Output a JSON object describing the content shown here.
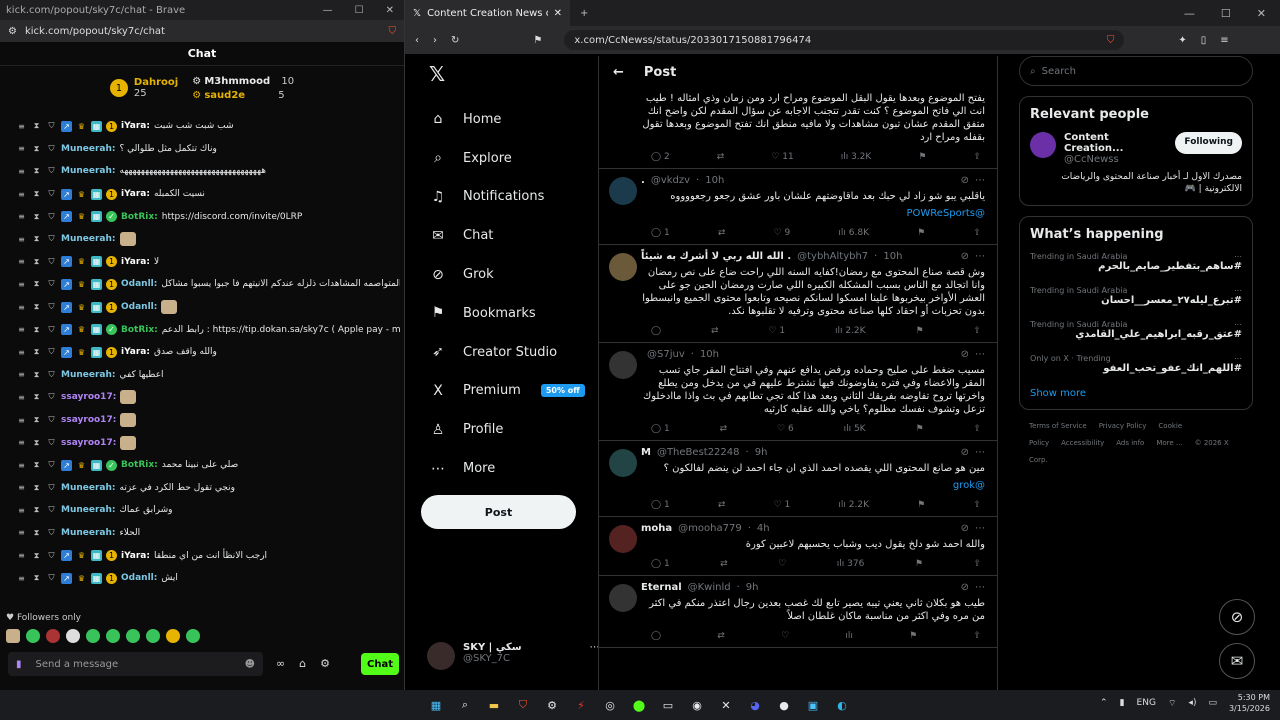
{
  "left_window": {
    "title": "kick.com/popout/sky7c/chat - Brave",
    "url": "kick.com/popout/sky7c/chat",
    "chat_title": "Chat",
    "leaderboard": [
      {
        "rank": "1",
        "name": "Dahrooj",
        "count": "25"
      },
      {
        "name": "M3hmmood",
        "count": "10"
      },
      {
        "name": "saud2e",
        "count": "5"
      }
    ],
    "messages": [
      {
        "user": "iYara:",
        "color": "#ffffff",
        "badges": [
          "b1",
          "b1",
          "b1",
          "b2",
          "b4",
          "b3",
          "b5"
        ],
        "text": "شب شبت شب شبت"
      },
      {
        "user": "Muneerah:",
        "color": "#7ec8e3",
        "badges": [
          "b1",
          "b1",
          "b1"
        ],
        "text": "وناك تتكمل مثل طلوالي ؟"
      },
      {
        "user": "Muneerah:",
        "color": "#7ec8e3",
        "badges": [
          "b1",
          "b1",
          "b1"
        ],
        "text": "ههههههههههههههههههههههههههههههههههه"
      },
      {
        "user": "iYara:",
        "color": "#ffffff",
        "badges": [
          "b1",
          "b1",
          "b1",
          "b2",
          "b4",
          "b3",
          "b5"
        ],
        "text": "نسيت الكمبله"
      },
      {
        "user": "BotRix:",
        "color": "#38c45a",
        "badges": [
          "b1",
          "b1",
          "b1",
          "b2",
          "b4",
          "b3",
          "b6"
        ],
        "text": "https://discord.com/invite/0LRP"
      },
      {
        "user": "Muneerah:",
        "color": "#7ec8e3",
        "badges": [
          "b1",
          "b1",
          "b1"
        ],
        "text": "",
        "emote": true
      },
      {
        "user": "iYara:",
        "color": "#ffffff",
        "badges": [
          "b1",
          "b1",
          "b1",
          "b2",
          "b4",
          "b3",
          "b5"
        ],
        "text": "لا"
      },
      {
        "user": "Odanll:",
        "color": "#7ec8e3",
        "badges": [
          "b1",
          "b1",
          "b1",
          "b2",
          "b4",
          "b3",
          "b5"
        ],
        "text": "للعزه الثانيه ويكمت تصري المتواصمه المشاهدات ذلزله عندكم الانيتهم فا جبوا يسبوا مشاكل"
      },
      {
        "user": "Odanll:",
        "color": "#7ec8e3",
        "badges": [
          "b1",
          "b1",
          "b1",
          "b2",
          "b4",
          "b3",
          "b5"
        ],
        "text": "",
        "emote": true
      },
      {
        "user": "BotRix:",
        "color": "#38c45a",
        "badges": [
          "b1",
          "b1",
          "b1",
          "b2",
          "b4",
          "b3",
          "b6"
        ],
        "text": "رابط الدعم : https://tip.dokan.sa/sky7c ( Apple pay - mada - Visa"
      },
      {
        "user": "iYara:",
        "color": "#ffffff",
        "badges": [
          "b1",
          "b1",
          "b1",
          "b2",
          "b4",
          "b3",
          "b5"
        ],
        "text": "والله واقف صدق"
      },
      {
        "user": "Muneerah:",
        "color": "#7ec8e3",
        "badges": [
          "b1",
          "b1",
          "b1"
        ],
        "text": "اعطيها كفي"
      },
      {
        "user": "ssayroo17:",
        "color": "#b084f5",
        "badges": [
          "b1",
          "b1",
          "b1"
        ],
        "text": "",
        "emote": true
      },
      {
        "user": "ssayroo17:",
        "color": "#b084f5",
        "badges": [
          "b1",
          "b1",
          "b1"
        ],
        "text": "",
        "emote": true
      },
      {
        "user": "ssayroo17:",
        "color": "#b084f5",
        "badges": [
          "b1",
          "b1",
          "b1"
        ],
        "text": "",
        "emote": true
      },
      {
        "user": "BotRix:",
        "color": "#38c45a",
        "badges": [
          "b1",
          "b1",
          "b1",
          "b2",
          "b4",
          "b3",
          "b6"
        ],
        "text": "صلي على نبينا محمد"
      },
      {
        "user": "Muneerah:",
        "color": "#7ec8e3",
        "badges": [
          "b1",
          "b1",
          "b1"
        ],
        "text": "ونجي تقول حط الكرد في عزته"
      },
      {
        "user": "Muneerah:",
        "color": "#7ec8e3",
        "badges": [
          "b1",
          "b1",
          "b1"
        ],
        "text": "وشرابق عماك"
      },
      {
        "user": "Muneerah:",
        "color": "#7ec8e3",
        "badges": [
          "b1",
          "b1",
          "b1"
        ],
        "text": "الحلاء"
      },
      {
        "user": "iYara:",
        "color": "#ffffff",
        "badges": [
          "b1",
          "b1",
          "b1",
          "b2",
          "b4",
          "b3",
          "b5"
        ],
        "text": "ارجب الانظأ انت من اي منطقا"
      },
      {
        "user": "Odanll:",
        "color": "#7ec8e3",
        "badges": [
          "b1",
          "b1",
          "b1",
          "b2",
          "b4",
          "b3",
          "b5"
        ],
        "text": "ايش"
      }
    ],
    "followers_only": "Followers only",
    "send_placeholder": "Send a message",
    "chat_button": "Chat"
  },
  "right_window": {
    "tab_title": "Content Creation News on X: \"",
    "url": "x.com/CcNewss/status/2033017150881796474",
    "nav": [
      {
        "label": "Home",
        "icon": "⌂"
      },
      {
        "label": "Explore",
        "icon": "⌕"
      },
      {
        "label": "Notifications",
        "icon": "♫"
      },
      {
        "label": "Chat",
        "icon": "✉"
      },
      {
        "label": "Grok",
        "icon": "⊘"
      },
      {
        "label": "Bookmarks",
        "icon": "⚑"
      },
      {
        "label": "Creator Studio",
        "icon": "➶"
      },
      {
        "label": "Premium",
        "icon": "X"
      },
      {
        "label": "Profile",
        "icon": "♙"
      },
      {
        "label": "More",
        "icon": "⋯"
      }
    ],
    "premium_badge": "50% off",
    "post_button": "Post",
    "account": {
      "name": "SKY | سكي",
      "handle": "@SKY_7C"
    },
    "feed_title": "Post",
    "tweets": [
      {
        "name": "",
        "handle": "",
        "time": "",
        "text": "يفتح الموضوع وبعدها يقول البقل الموضوع ومراح ارد ومن زمان وذي امثاله ! طيب انت الي فاتح الموضوع ؟ كنت تقدر تتجنب الاجابه عن سؤال المقدم لكن واضح انك متفق المقدم عشان تبون مشاهدات ولا مافيه منطق انك تفتح الموضوع وبعدها تقول بقفله ومراح ارد",
        "link": "",
        "replies": "2",
        "reposts": "",
        "likes": "11",
        "views": "3.2K"
      },
      {
        "name": ".",
        "handle": "@vkdzv",
        "time": "10h",
        "text": "ياقلبي يبو شو زاد لي حبك بعد ماقاوضتهم علشان باور عشق رجعو رجعووووه",
        "link": "@POWReSports",
        "replies": "1",
        "reposts": "",
        "likes": "9",
        "views": "6.8K"
      },
      {
        "name": "الله الله ربي لا أشرك به شيئاً .",
        "handle": "@tybhAltybh7",
        "time": "10h",
        "text": "وش قصة صناع المحتوى مع رمضان!كفايه السنه اللي راحت ضاع على نص رمضان وانا اتجالد مع الناس بسبب المشكله الكبيره اللي صارت ورمضان الحين جو على العشر الأواخر بيخربوها علينا امسكوا لسانكم نصيحه وتابعوا محتوى الجميع وانبسطوا بدون تحزبات أو احقاد كلها صناعة محتوى وترفيه لا تقلبوها نكد.",
        "link": "",
        "replies": "",
        "reposts": "",
        "likes": "1",
        "views": "2.2K"
      },
      {
        "name": "",
        "handle": "@S7juv",
        "time": "10h",
        "text": "مسيب ضغط على صليح وحماده ورفض يدافع عنهم وفي افتتاح المقر جاي تسب المقر والاعضاء وفي فتره يفاوضونك فيها تشترط عليهم في من يدخل ومن يطلع واخرتها تروح تفاوضه بفريقك الثاني وبعد هذا كله تجي تطابهم في بث واذا ماادخلوك تزعل وتشوف نفسك مظلوم؟ ياخي والله عقليه كارثيه",
        "link": "",
        "replies": "1",
        "reposts": "",
        "likes": "6",
        "views": "5K"
      },
      {
        "name": "M",
        "handle": "@TheBest22248",
        "time": "9h",
        "text": "مين هو صانع المحتوى اللي يقصده احمد الذي ان جاء احمد لن ينضم لفالكون ؟",
        "link": "@grok",
        "replies": "1",
        "reposts": "",
        "likes": "1",
        "views": "2.2K"
      },
      {
        "name": "moha",
        "handle": "@mooha779",
        "time": "4h",
        "text": "والله احمد شو دلخ يقول ديب وشباب يحسبهم لاعبين كورة",
        "link": "",
        "replies": "1",
        "reposts": "",
        "likes": "",
        "views": "376"
      },
      {
        "name": "Eternal",
        "handle": "@Kwinld",
        "time": "9h",
        "text": "طيب هو بكلان ثاني يعني تيبه يصير تابع لك غصب بعدين رجال اعتذر منكم في اكثر من مره وفي اكثر من مناسبة ماكان غلطان اصلاً",
        "link": "",
        "replies": "",
        "reposts": "",
        "likes": "",
        "views": ""
      }
    ],
    "search_placeholder": "Search",
    "relevant_title": "Relevant people",
    "relevant": {
      "name": "Content Creation...",
      "handle": "@CcNewss",
      "bio": "مصدرك الاول لـ أخبار صناعة المحتوى والرياضات الالكترونية | 🎮",
      "follow_label": "Following"
    },
    "happening_title": "What’s happening",
    "trends": [
      {
        "sub": "Trending in Saudi Arabia",
        "tag": "#ساهم_بتفطير_صايم_بالحرم"
      },
      {
        "sub": "Trending in Saudi Arabia",
        "tag": "#تبرع_ليله٢٧_معسر__احسان"
      },
      {
        "sub": "Trending in Saudi Arabia",
        "tag": "#عتق_رقبه_ابراهيم_علي_القامدي"
      },
      {
        "sub": "Only on X · Trending",
        "tag": "#اللهم_انك_عفو_تحب_العفو"
      }
    ],
    "show_more": "Show more",
    "footer": [
      "Terms of Service",
      "Privacy Policy",
      "Cookie Policy",
      "Accessibility",
      "Ads info",
      "More ...",
      "© 2026 X Corp."
    ]
  },
  "taskbar": {
    "lang": "ENG",
    "time": "5:30 PM",
    "date": "3/15/2026"
  }
}
